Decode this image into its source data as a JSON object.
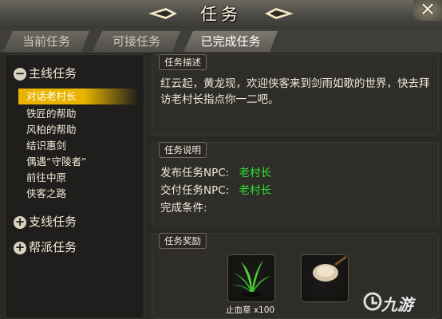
{
  "window": {
    "title": "任务",
    "close_glyph": "✕"
  },
  "tabs": [
    {
      "label": "当前任务",
      "active": false
    },
    {
      "label": "可接任务",
      "active": false
    },
    {
      "label": "已完成任务",
      "active": true
    }
  ],
  "sidebar": {
    "main_category": {
      "label": "主线任务",
      "expanded": true,
      "toggle": "−"
    },
    "quests": [
      {
        "label": "对话老村长",
        "selected": true
      },
      {
        "label": "铁匠的帮助"
      },
      {
        "label": "风柏的帮助"
      },
      {
        "label": "结识惠剑"
      },
      {
        "label": "偶遇“守陵者”"
      },
      {
        "label": "前往中原"
      },
      {
        "label": "侠客之路"
      }
    ],
    "side_category": {
      "label": "支线任务",
      "toggle": "+"
    },
    "guild_category": {
      "label": "帮派任务",
      "toggle": "+"
    }
  },
  "description": {
    "label": "任务描述",
    "text": "红云起，黄龙现，欢迎侠客来到剑雨如歌的世界，快去拜访老村长指点你一二吧。"
  },
  "info": {
    "label": "任务说明",
    "issue_label": "发布任务NPC:",
    "issue_npc": "老村长",
    "submit_label": "交付任务NPC:",
    "submit_npc": "老村长",
    "condition_label": "完成条件:"
  },
  "rewards": {
    "label": "任务奖励",
    "items": [
      {
        "name": "止血草 x100",
        "icon": "herb-icon"
      },
      {
        "name": "",
        "icon": "item-icon"
      }
    ]
  },
  "watermark": "九游",
  "colors": {
    "accent": "#e8b400",
    "npc": "#2fe22f"
  }
}
